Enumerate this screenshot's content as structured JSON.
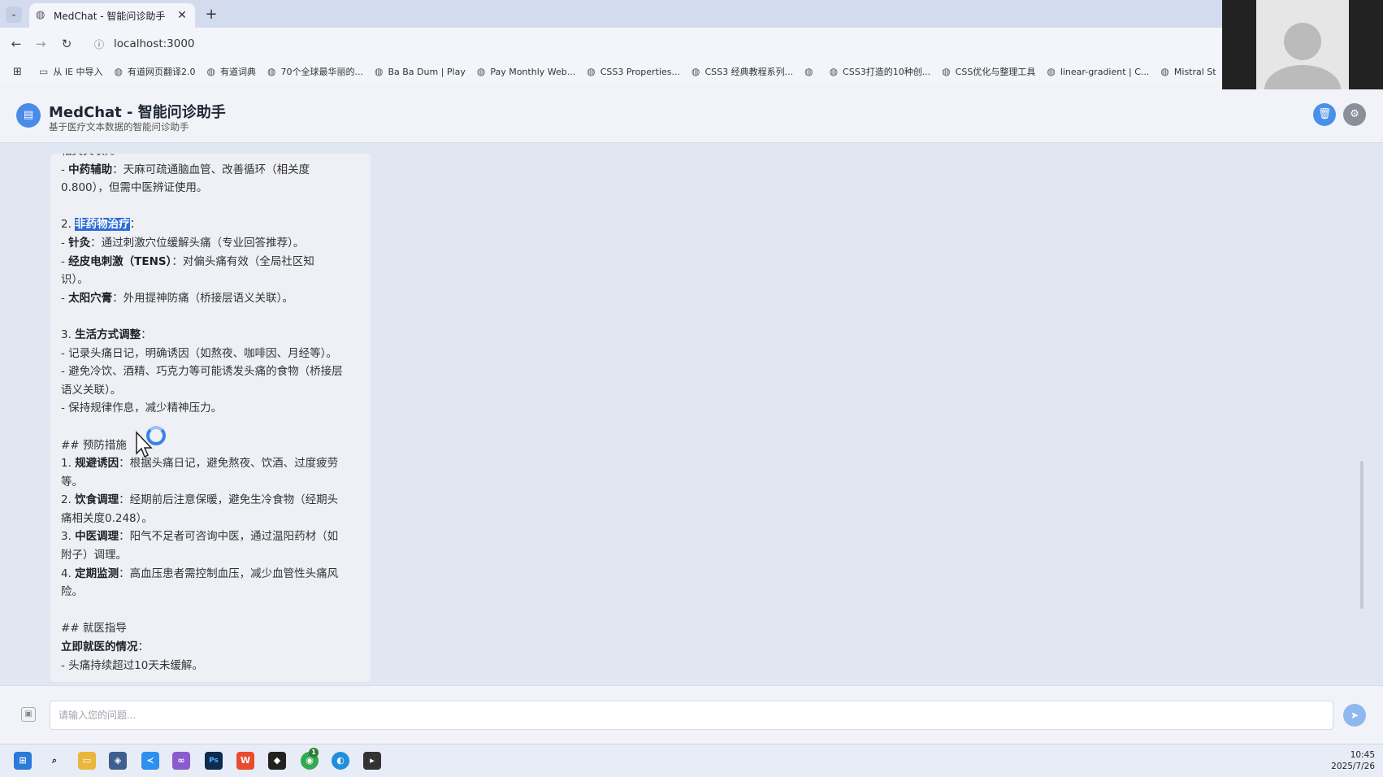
{
  "browser": {
    "tab_title": "MedChat - 智能问诊助手",
    "tab_close": "✕",
    "new_tab": "+",
    "url": "localhost:3000",
    "bookmarks": [
      {
        "label": "从 IE 中导入",
        "icon": "folder-icon"
      },
      {
        "label": "有道网页翻译2.0",
        "icon": "globe-icon"
      },
      {
        "label": "有道词典",
        "icon": "globe-icon"
      },
      {
        "label": "70个全球最华丽的...",
        "icon": "globe-icon"
      },
      {
        "label": "Ba Ba Dum | Play",
        "icon": "globe-icon"
      },
      {
        "label": "Pay Monthly Web...",
        "icon": "globe-icon"
      },
      {
        "label": "CSS3 Properties...",
        "icon": "globe-icon"
      },
      {
        "label": "CSS3 经典教程系列...",
        "icon": "globe-icon"
      },
      {
        "label": "",
        "icon": "globe-icon"
      },
      {
        "label": "CSS3打造的10种创...",
        "icon": "globe-icon"
      },
      {
        "label": "CSS优化与整理工具",
        "icon": "globe-icon"
      },
      {
        "label": "linear-gradient | C...",
        "icon": "globe-icon"
      },
      {
        "label": "Mistral St",
        "icon": "globe-icon"
      }
    ]
  },
  "app": {
    "title": "MedChat - 智能问诊助手",
    "subtitle": "基于医疗文本数据的智能问诊助手"
  },
  "message": {
    "lines": [
      {
        "bold": "",
        "text": "相关关联）。"
      },
      {
        "bold": "中药辅助",
        "prefix": "- ",
        "text": "：天麻可疏通脑血管、改善循环（相关度"
      },
      {
        "bold": "",
        "text": "0.800），但需中医辨证使用。"
      },
      {
        "bold": "",
        "text": ""
      },
      {
        "bold": "非药物治疗",
        "prefix": "2. ",
        "text": "：",
        "highlight": true
      },
      {
        "bold": "针灸",
        "prefix": "- ",
        "text": "：通过刺激穴位缓解头痛（专业回答推荐）。"
      },
      {
        "bold": "经皮电刺激（TENS）",
        "prefix": "- ",
        "text": "：对偏头痛有效（全局社区知"
      },
      {
        "bold": "",
        "text": "识）。"
      },
      {
        "bold": "太阳穴膏",
        "prefix": "- ",
        "text": "：外用提神防痛（桥接层语义关联）。"
      },
      {
        "bold": "",
        "text": ""
      },
      {
        "bold": "生活方式调整",
        "prefix": "3. ",
        "text": "："
      },
      {
        "bold": "",
        "text": "- 记录头痛日记，明确诱因（如熬夜、咖啡因、月经等）。"
      },
      {
        "bold": "",
        "text": "- 避免冷饮、酒精、巧克力等可能诱发头痛的食物（桥接层"
      },
      {
        "bold": "",
        "text": "语义关联）。"
      },
      {
        "bold": "",
        "text": "- 保持规律作息，减少精神压力。"
      },
      {
        "bold": "",
        "text": ""
      },
      {
        "bold": "",
        "text": "## 预防措施"
      },
      {
        "bold": "规避诱因",
        "prefix": "1. ",
        "text": "：根据头痛日记，避免熬夜、饮酒、过度疲劳"
      },
      {
        "bold": "",
        "text": "等。"
      },
      {
        "bold": "饮食调理",
        "prefix": "2. ",
        "text": "：经期前后注意保暖，避免生冷食物（经期头"
      },
      {
        "bold": "",
        "text": "痛相关度0.248）。"
      },
      {
        "bold": "中医调理",
        "prefix": "3. ",
        "text": "：阳气不足者可咨询中医，通过温阳药材（如"
      },
      {
        "bold": "",
        "text": "附子）调理。"
      },
      {
        "bold": "定期监测",
        "prefix": "4. ",
        "text": "：高血压患者需控制血压，减少血管性头痛风"
      },
      {
        "bold": "",
        "text": "险。"
      },
      {
        "bold": "",
        "text": ""
      },
      {
        "bold": "",
        "text": "## 就医指导"
      },
      {
        "bold": "立即就医的情况",
        "prefix": "",
        "text": "："
      },
      {
        "bold": "",
        "text": "- 头痛持续超过10天未缓解。"
      }
    ]
  },
  "input": {
    "placeholder": "请输入您的问题..."
  },
  "taskbar": {
    "time": "10:45",
    "date": "2025/7/26",
    "badge": "1"
  },
  "colors": {
    "accent": "#4a8ae8",
    "highlight": "#2c6cd6",
    "send_disabled": "#8fb8ee"
  }
}
